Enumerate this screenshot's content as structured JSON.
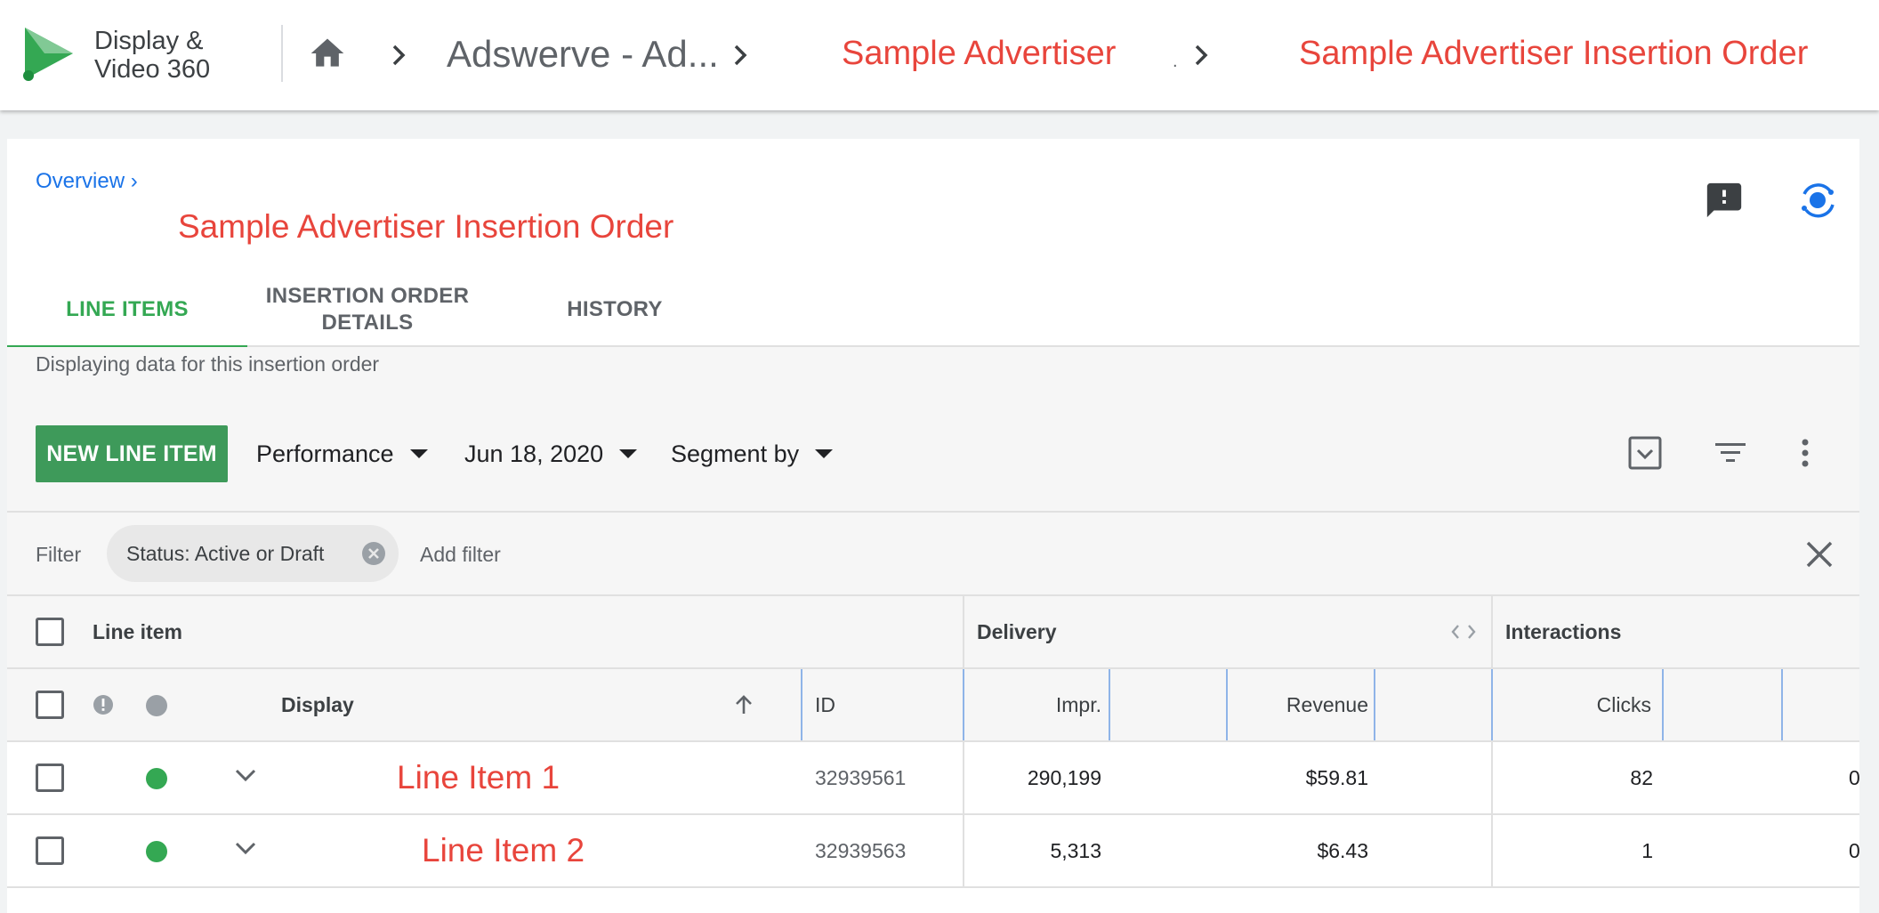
{
  "header": {
    "product_line1": "Display &",
    "product_line2": "Video 360",
    "breadcrumbs": [
      "Adswerve - Ad...",
      "Sample Advertiser",
      "Sample Advertiser Insertion Order"
    ],
    "separator_mark": "."
  },
  "page": {
    "overview_link": "Overview ›",
    "title": "Sample Advertiser Insertion Order",
    "tabs": [
      {
        "label": "LINE ITEMS",
        "active": true
      },
      {
        "label": "INSERTION ORDER DETAILS",
        "active": false
      },
      {
        "label": "HISTORY",
        "active": false
      }
    ],
    "info_text": "Displaying data for this insertion order"
  },
  "toolbar": {
    "new_button": "NEW LINE ITEM",
    "view_dropdown": "Performance",
    "date_dropdown": "Jun 18, 2020",
    "segment_dropdown": "Segment by"
  },
  "filters": {
    "label": "Filter",
    "chip": "Status: Active or Draft",
    "add_filter": "Add filter"
  },
  "table": {
    "groups": {
      "line_item": "Line item",
      "delivery": "Delivery",
      "interactions": "Interactions"
    },
    "columns": {
      "display": "Display",
      "id": "ID",
      "impr": "Impr.",
      "revenue": "Revenue",
      "clicks": "Clicks"
    },
    "rows": [
      {
        "name": "Line Item 1",
        "id": "32939561",
        "impr": "290,199",
        "revenue": "$59.81",
        "clicks": "82",
        "overflow": "0"
      },
      {
        "name": "Line Item 2",
        "id": "32939563",
        "impr": "5,313",
        "revenue": "$6.43",
        "clicks": "1",
        "overflow": "0"
      }
    ]
  },
  "colors": {
    "accent_green": "#34a853",
    "button_green": "#3e9a5a",
    "status_active": "#34a853",
    "redaction_red": "#e8453c",
    "link_blue": "#1a73e8"
  },
  "icons": [
    "dv360-logo-icon",
    "home-icon",
    "chevron-right-icon",
    "feedback-icon",
    "orbit-icon",
    "caret-down-icon",
    "column-toggle-icon",
    "filter-list-icon",
    "more-vert-icon",
    "close-icon",
    "arrow-up-icon",
    "chevron-down-icon",
    "warning-circle-icon"
  ]
}
